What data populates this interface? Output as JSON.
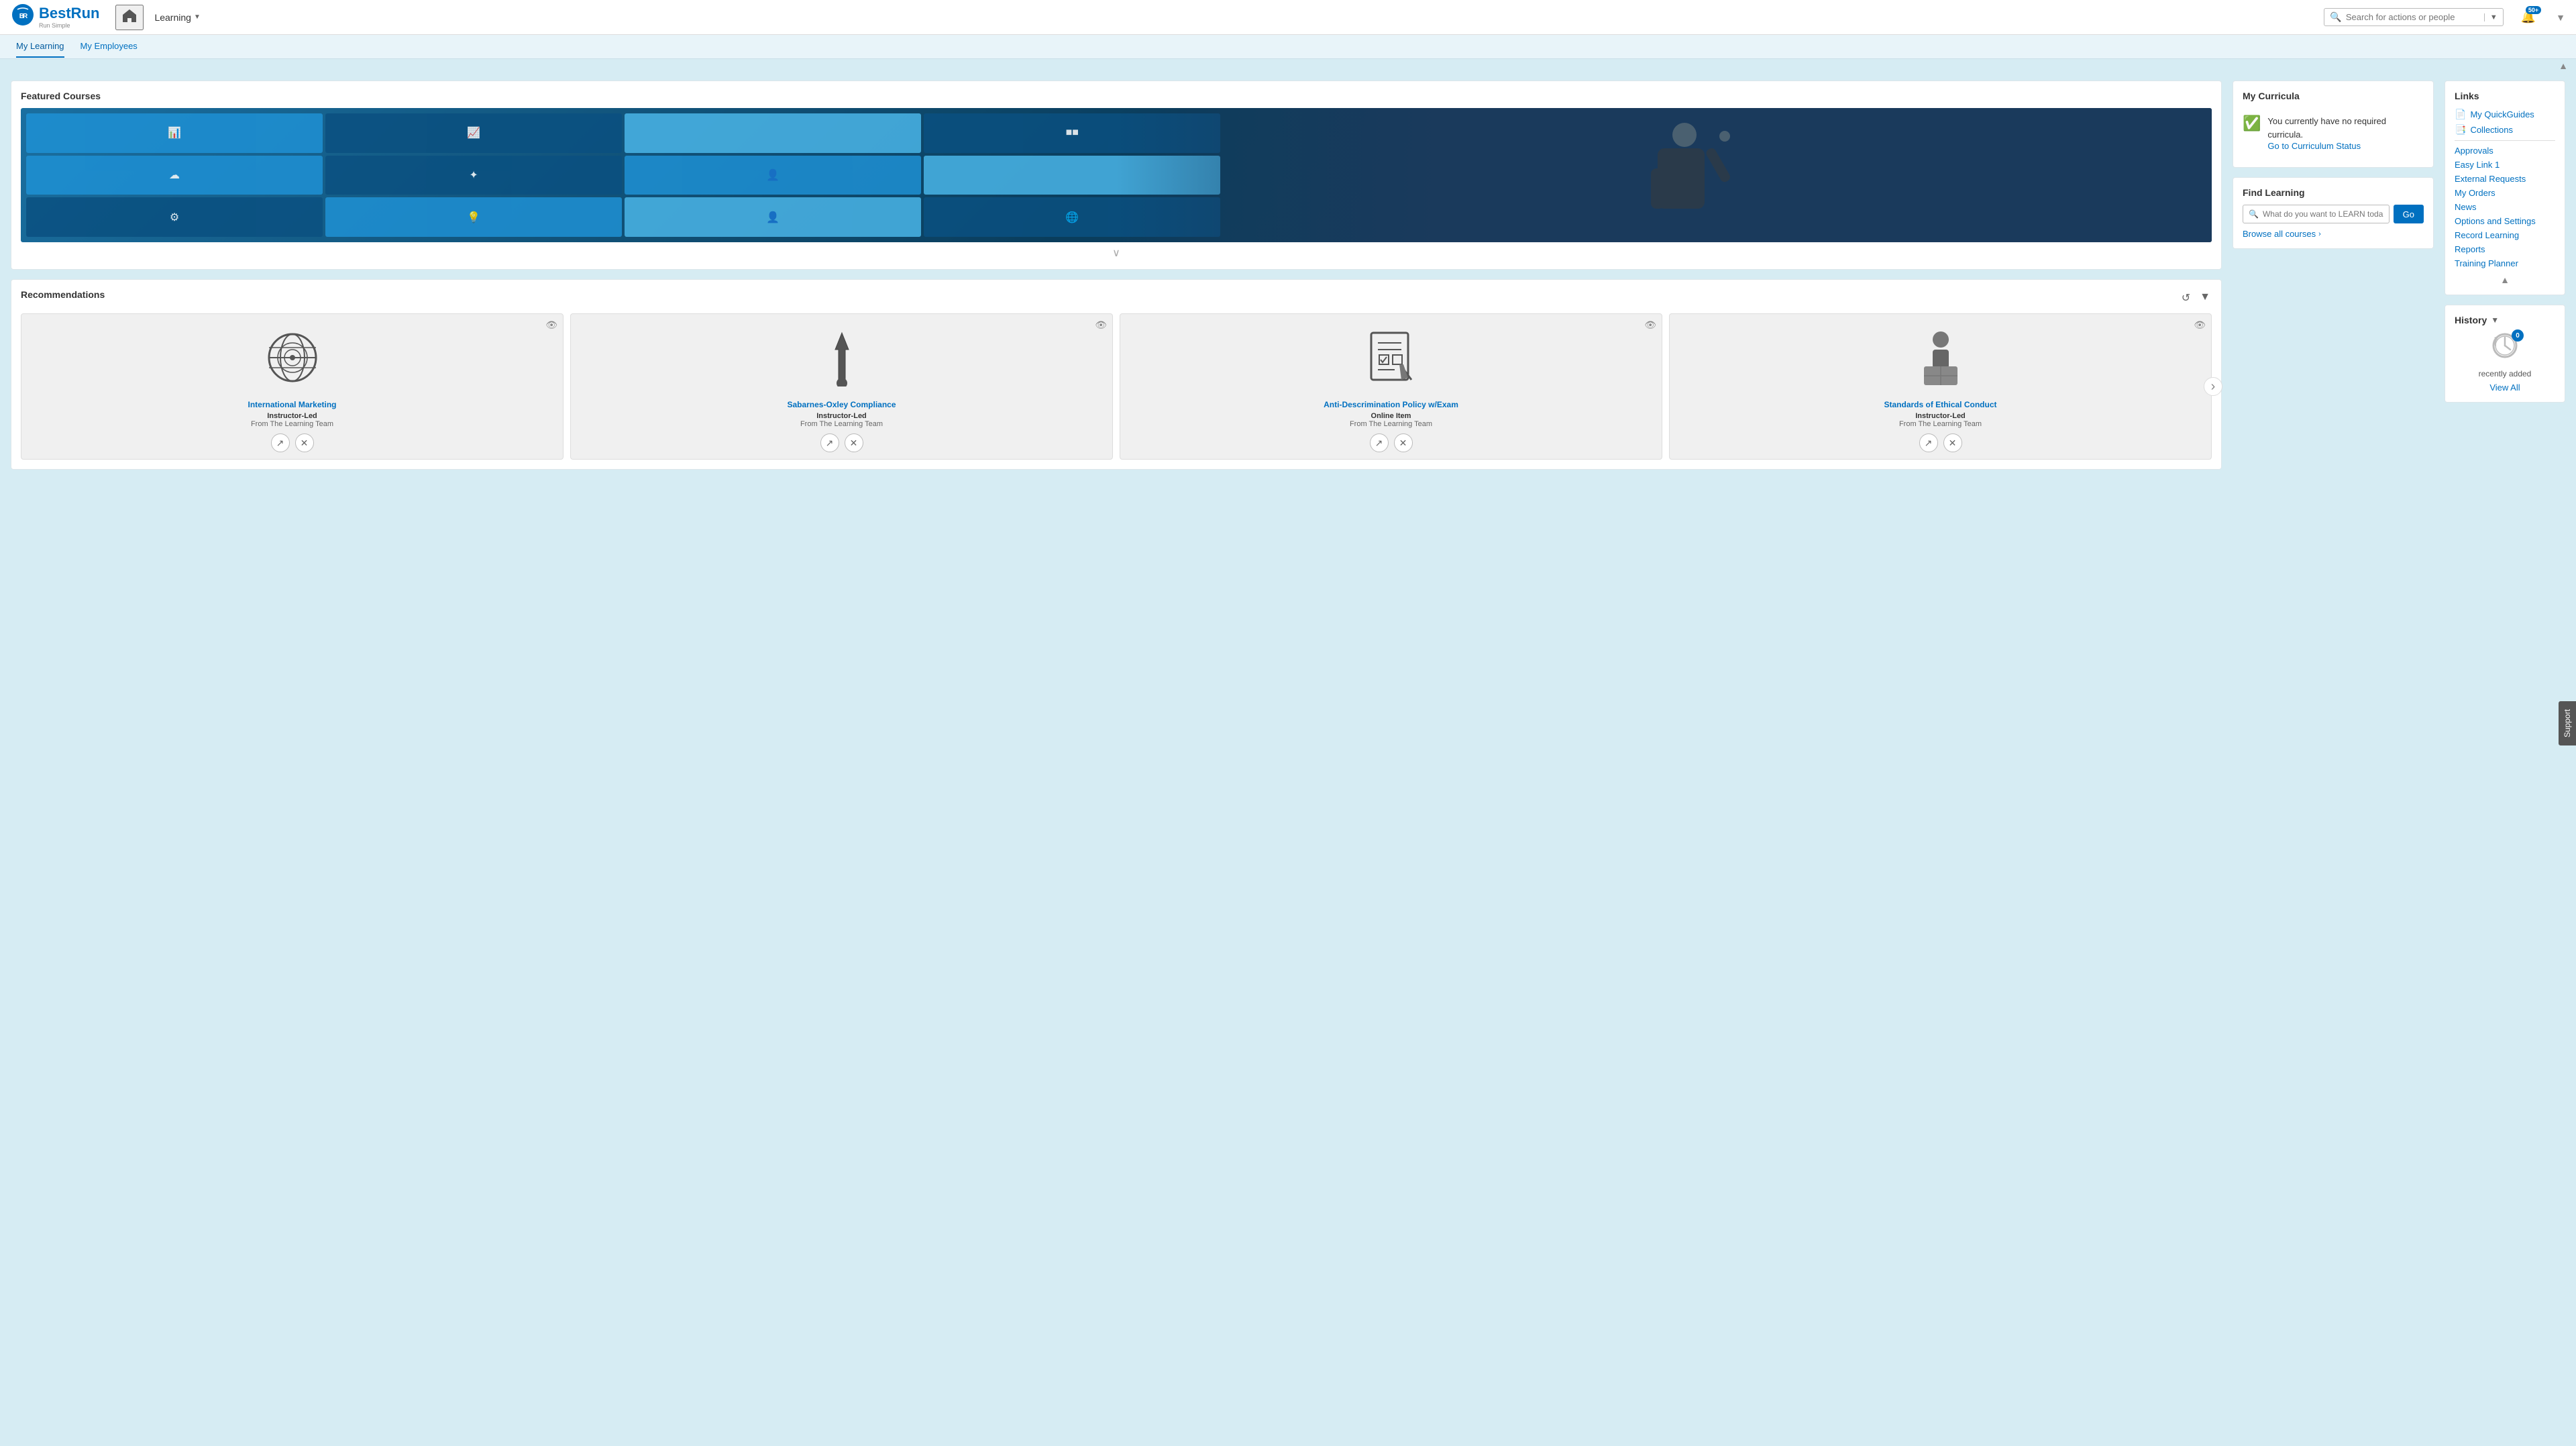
{
  "app": {
    "title": "BestRun",
    "subtitle": "Run Simple"
  },
  "topnav": {
    "home_label": "Home",
    "learning_label": "Learning",
    "search_placeholder": "Search for actions or people",
    "notifications_count": "50+",
    "dropdown_label": "▼"
  },
  "subnav": {
    "items": [
      {
        "id": "my-learning",
        "label": "My Learning",
        "active": true
      },
      {
        "id": "my-employees",
        "label": "My Employees",
        "active": false
      }
    ]
  },
  "featured": {
    "title": "Featured Courses",
    "chevron_down": "∨"
  },
  "curricula": {
    "title": "My Curricula",
    "message": "You currently have no required curricula.",
    "link": "Go to Curriculum Status"
  },
  "find_learning": {
    "title": "Find Learning",
    "search_placeholder": "What do you want to LEARN toda...",
    "go_button": "Go",
    "browse_label": "Browse all courses",
    "browse_chevron": "›"
  },
  "recommendations": {
    "title": "Recommendations",
    "courses": [
      {
        "id": "intl-marketing",
        "title": "International Marketing",
        "type": "Instructor-Led",
        "source": "From The Learning Team",
        "icon": "🌐"
      },
      {
        "id": "sarbanes-oxley",
        "title": "Sabarnes-Oxley Compliance",
        "type": "Instructor-Led",
        "source": "From The Learning Team",
        "icon": "❗"
      },
      {
        "id": "anti-discrimination",
        "title": "Anti-Descrimination Policy w/Exam",
        "type": "Online Item",
        "source": "From The Learning Team",
        "icon": "📋"
      },
      {
        "id": "standards-conduct",
        "title": "Standards of Ethical Conduct",
        "type": "Instructor-Led",
        "source": "From The Learning Team",
        "icon": "📦"
      }
    ]
  },
  "links": {
    "title": "Links",
    "items": [
      {
        "id": "quickguides",
        "label": "My QuickGuides",
        "has_icon": true
      },
      {
        "id": "collections",
        "label": "Collections",
        "has_icon": true
      },
      {
        "id": "approvals",
        "label": "Approvals",
        "has_icon": false
      },
      {
        "id": "easylink",
        "label": "Easy Link 1",
        "has_icon": false
      },
      {
        "id": "ext-requests",
        "label": "External Requests",
        "has_icon": false
      },
      {
        "id": "my-orders",
        "label": "My Orders",
        "has_icon": false
      },
      {
        "id": "news",
        "label": "News",
        "has_icon": false
      },
      {
        "id": "options",
        "label": "Options and Settings",
        "has_icon": false
      },
      {
        "id": "record-learning",
        "label": "Record Learning",
        "has_icon": false
      },
      {
        "id": "reports",
        "label": "Reports",
        "has_icon": false
      },
      {
        "id": "training-planner",
        "label": "Training Planner",
        "has_icon": false
      }
    ]
  },
  "history": {
    "title": "History",
    "badge_count": "0",
    "recently_added": "recently added",
    "view_all": "View All"
  },
  "support": {
    "label": "Support"
  }
}
